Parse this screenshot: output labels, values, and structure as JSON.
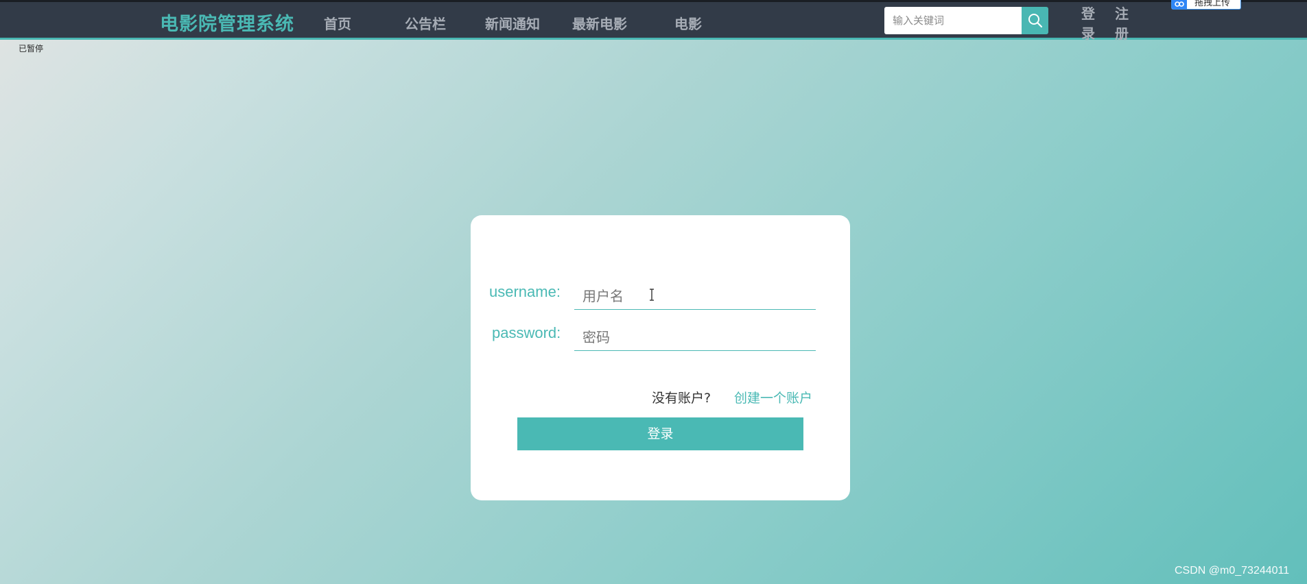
{
  "header": {
    "brand": "电影院管理系统",
    "nav": [
      {
        "label": "首页"
      },
      {
        "label": "公告栏"
      },
      {
        "label": "新闻通知"
      },
      {
        "label": "最新电影"
      },
      {
        "label": "电影"
      }
    ],
    "search": {
      "placeholder": "输入关键词",
      "icon": "search-icon"
    },
    "login_label": "登录",
    "register_label": "注册",
    "upload_badge": "拖拽上传"
  },
  "pause_label": "已暂停",
  "login_form": {
    "username_label": "username:",
    "username_placeholder": "用户名",
    "password_label": "password:",
    "password_placeholder": "密码",
    "no_account_text": "没有账户?",
    "create_account_link": "创建一个账户",
    "submit_label": "登录"
  },
  "watermark": "CSDN @m0_73244011",
  "colors": {
    "accent": "#4ab9b4",
    "header_bg": "#323b48",
    "nav_text": "#a7adb6",
    "card_bg": "#ffffff"
  }
}
